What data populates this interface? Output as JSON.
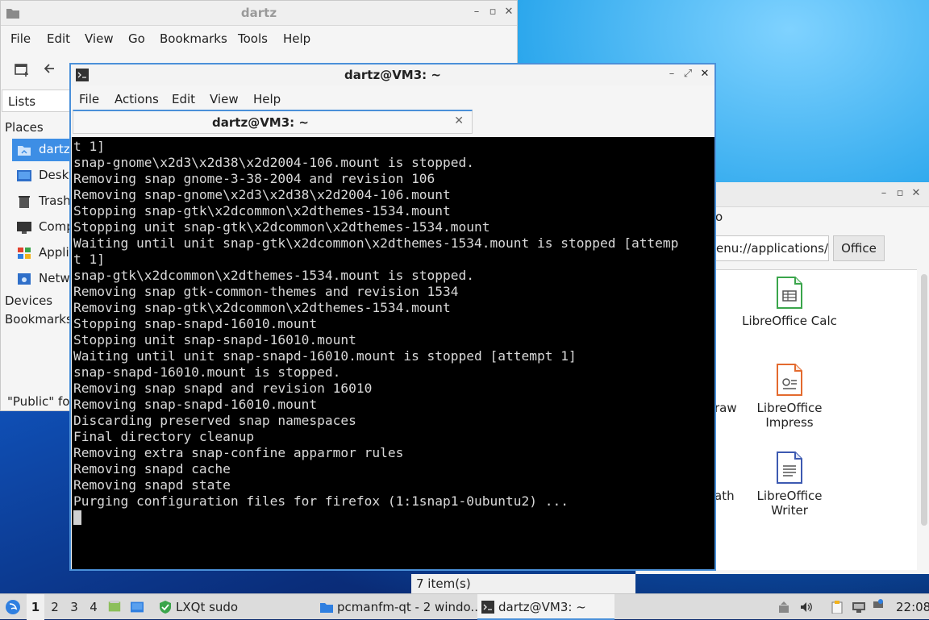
{
  "file_manager": {
    "title": "dartz",
    "menu": [
      "File",
      "Edit",
      "View",
      "Go",
      "Bookmarks",
      "Tools",
      "Help"
    ],
    "sidebar_tab": "Lists",
    "places_heading": "Places",
    "places": [
      "dartz",
      "Deskt",
      "Trash",
      "Comp",
      "Applic",
      "Netw"
    ],
    "devices_heading": "Devices",
    "bookmarks_heading": "Bookmarks",
    "status": "\"Public\" fol"
  },
  "apps_window": {
    "path_value": "enu://applications/",
    "breadcrumb": "Office",
    "items": [
      {
        "label": "LibreOffice Calc",
        "icon": "calc-icon",
        "color": "#3aa54b"
      },
      {
        "label": "LibreOffice Impress",
        "icon": "impress-icon",
        "color": "#e36a2e"
      },
      {
        "label": "LibreOffice Writer",
        "icon": "writer-icon",
        "color": "#3d5ab1"
      }
    ],
    "partial_labels": [
      "o",
      "raw",
      "ath"
    ],
    "status": "7 item(s)"
  },
  "terminal": {
    "title": "dartz@VM3: ~",
    "menu": [
      "File",
      "Actions",
      "Edit",
      "View",
      "Help"
    ],
    "tab_label": "dartz@VM3: ~",
    "lines": [
      "t 1]",
      "snap-gnome\\x2d3\\x2d38\\x2d2004-106.mount is stopped.",
      "Removing snap gnome-3-38-2004 and revision 106",
      "Removing snap-gnome\\x2d3\\x2d38\\x2d2004-106.mount",
      "Stopping snap-gtk\\x2dcommon\\x2dthemes-1534.mount",
      "Stopping unit snap-gtk\\x2dcommon\\x2dthemes-1534.mount",
      "Waiting until unit snap-gtk\\x2dcommon\\x2dthemes-1534.mount is stopped [attemp",
      "t 1]",
      "snap-gtk\\x2dcommon\\x2dthemes-1534.mount is stopped.",
      "Removing snap gtk-common-themes and revision 1534",
      "Removing snap-gtk\\x2dcommon\\x2dthemes-1534.mount",
      "Stopping snap-snapd-16010.mount",
      "Stopping unit snap-snapd-16010.mount",
      "Waiting until unit snap-snapd-16010.mount is stopped [attempt 1]",
      "snap-snapd-16010.mount is stopped.",
      "Removing snap snapd and revision 16010",
      "Removing snap-snapd-16010.mount",
      "Discarding preserved snap namespaces",
      "Final directory cleanup",
      "Removing extra snap-confine apparmor rules",
      "Removing snapd cache",
      "Removing snapd state",
      "Purging configuration files for firefox (1:1snap1-0ubuntu2) ..."
    ]
  },
  "taskbar": {
    "workspaces": [
      "1",
      "2",
      "3",
      "4"
    ],
    "active_workspace": "1",
    "tasks": [
      "LXQt sudo",
      "pcmanfm-qt - 2 windo...",
      "dartz@VM3: ~"
    ],
    "clock": "22:08"
  },
  "colors": {
    "accent": "#4a90d9",
    "selection": "#3d8ee5",
    "terminal_bg": "#000000",
    "terminal_fg": "#d9d9d9"
  }
}
